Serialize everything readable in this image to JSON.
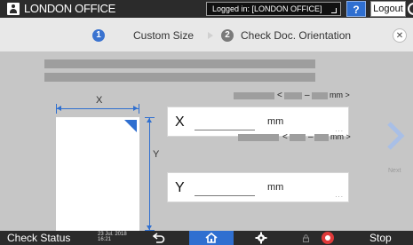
{
  "header": {
    "office": "LONDON OFFICE",
    "login": "Logged in: [LONDON OFFICE]",
    "help_label": "?",
    "logout_label": "Logout"
  },
  "steps": [
    {
      "num": "1",
      "label": "Custom Size"
    },
    {
      "num": "2",
      "label": "Check Doc. Orientation"
    }
  ],
  "diagram": {
    "x_label": "X",
    "y_label": "Y"
  },
  "range": {
    "lt": "<",
    "dash": "–",
    "unit": "mm >"
  },
  "inputs": {
    "x": {
      "letter": "X",
      "value": "",
      "unit": "mm",
      "dots": "..."
    },
    "y": {
      "letter": "Y",
      "value": "",
      "unit": "mm",
      "dots": "..."
    }
  },
  "next_label": "Next",
  "footer": {
    "check_status": "Check Status",
    "date": "23 Jul. 2018",
    "time": "16:21",
    "stop_label": "Stop"
  },
  "colors": {
    "accent": "#2f6fd0",
    "topbar": "#2b2b2b",
    "stop": "#e03a3a"
  },
  "icons": [
    "user-icon",
    "help-icon",
    "power-icon",
    "close-icon",
    "next-icon",
    "back-icon",
    "home-icon",
    "gear-icon",
    "lock-icon",
    "stop-icon"
  ]
}
